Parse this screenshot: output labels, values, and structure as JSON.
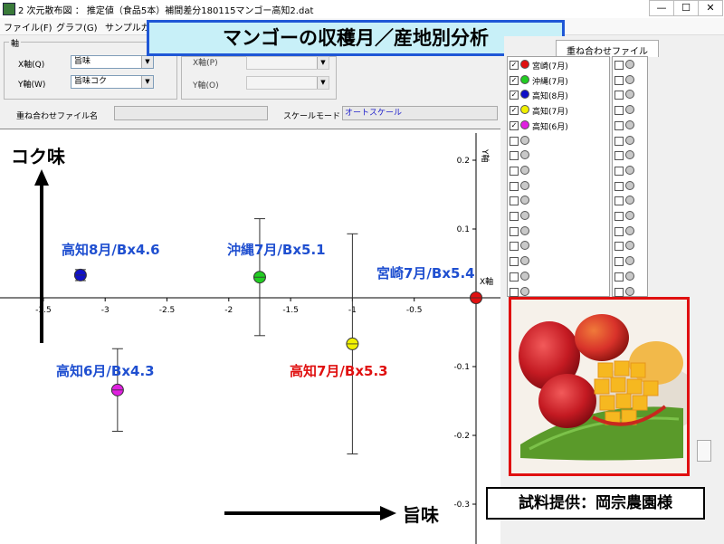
{
  "window": {
    "title": "2 次元散布図 ： 推定値（食品5本）補間差分180115マンゴー高知2.dat",
    "min": "—",
    "max": "☐",
    "close": "✕"
  },
  "menu": [
    "ファイル(F)",
    "グラフ(G)",
    "サンプルカ"
  ],
  "banner": "マンゴーの収穫月／産地別分析",
  "axis_group": {
    "title": "軸",
    "x_label": "X軸(Q)",
    "x_value": "旨味",
    "y_label": "Y軸(W)",
    "y_value": "旨味コク",
    "x2_label": "X軸(P)",
    "y2_label": "Y軸(O)"
  },
  "overlay_file": {
    "label": "重ね合わせファイル名",
    "value": ""
  },
  "scale_mode": {
    "label": "スケールモード",
    "value": "オートスケール"
  },
  "tab": "重ね合わせファイル",
  "legend": [
    {
      "label": "宮崎(7月)",
      "color": "#e01010",
      "checked": true
    },
    {
      "label": "沖縄(7月)",
      "color": "#22cc22",
      "checked": true
    },
    {
      "label": "高知(8月)",
      "color": "#1010c8",
      "checked": true
    },
    {
      "label": "高知(7月)",
      "color": "#f0f000",
      "checked": true
    },
    {
      "label": "高知(6月)",
      "color": "#e020e0",
      "checked": true
    }
  ],
  "chart_data": {
    "type": "scatter",
    "x_ticks": [
      "-3.5",
      "-3",
      "-2.5",
      "-2",
      "-1.5",
      "-1",
      "-0.5"
    ],
    "y_ticks": [
      "0.2",
      "0.1",
      "-0.1",
      "-0.2",
      "-0.3"
    ],
    "x_axis_label": "X軸",
    "y_axis_label": "Y軸",
    "xlim": [
      -3.9,
      0.1
    ],
    "ylim": [
      -0.3,
      0.23
    ],
    "series": [
      {
        "name": "宮崎(7月)",
        "x": 0.0,
        "y": 0.0,
        "yerr": 0.0,
        "color": "#e01010"
      },
      {
        "name": "沖縄(7月)",
        "x": -1.75,
        "y": 0.03,
        "yerr": 0.085,
        "color": "#22cc22"
      },
      {
        "name": "高知(8月)",
        "x": -3.2,
        "y": 0.033,
        "yerr": 0.008,
        "color": "#1010c8"
      },
      {
        "name": "高知(7月)",
        "x": -1.0,
        "y": -0.067,
        "yerr": 0.16,
        "color": "#f0f000"
      },
      {
        "name": "高知(6月)",
        "x": -2.9,
        "y": -0.134,
        "yerr": 0.06,
        "color": "#e020e0"
      }
    ]
  },
  "annotations": {
    "y_axis_title": "コク味",
    "x_axis_title": "旨味",
    "kochi8": "高知8月/Bx4.6",
    "okinawa7": "沖縄7月/Bx5.1",
    "miyazaki7": "宮崎7月/Bx5.4",
    "kochi6": "高知6月/Bx4.3",
    "kochi7": "高知7月/Bx5.3"
  },
  "credit": "試料提供：岡宗農園様",
  "colors": {
    "blue_text": "#1f4fd0",
    "red_text": "#e01010",
    "frame_red": "#e01010",
    "banner_border": "#1f57d6",
    "banner_fill": "#c8f0f8"
  }
}
